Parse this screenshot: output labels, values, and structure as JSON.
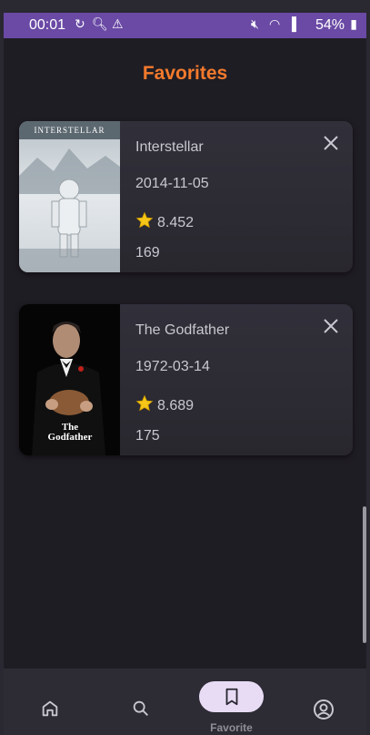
{
  "status_bar": {
    "time": "00:01",
    "battery": "54%"
  },
  "page": {
    "title": "Favorites"
  },
  "favorites": [
    {
      "title": "Interstellar",
      "release_date": "2014-11-05",
      "rating": "8.452",
      "runtime": "169",
      "poster_text": "INTERSTELLAR"
    },
    {
      "title": "The Godfather",
      "release_date": "1972-03-14",
      "rating": "8.689",
      "runtime": "175",
      "poster_text": "The Godfather"
    }
  ],
  "nav": {
    "items": [
      {
        "icon": "home-icon"
      },
      {
        "icon": "search-icon"
      },
      {
        "icon": "bookmark-icon",
        "label": "Favorite",
        "active": true
      },
      {
        "icon": "profile-icon"
      }
    ]
  },
  "colors": {
    "accent": "#f47a2c",
    "status_bar": "#6a4aa5",
    "background": "#1f1d24",
    "card": "#312f39",
    "active_pill": "#e8dcf5"
  }
}
